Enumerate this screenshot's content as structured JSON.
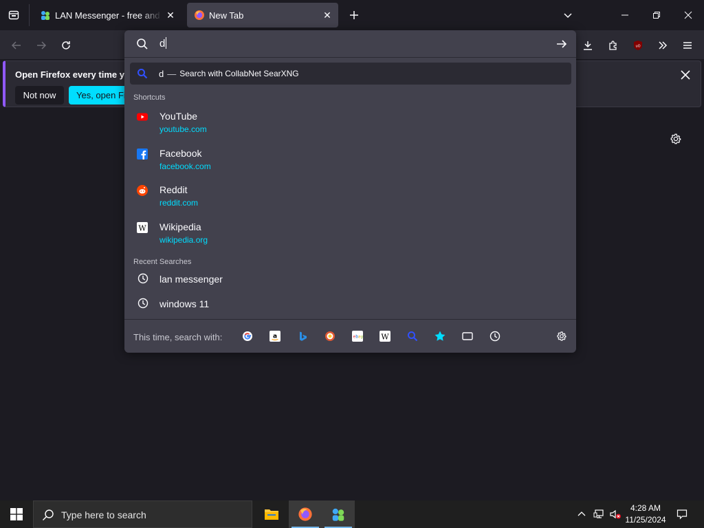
{
  "tabs": [
    {
      "title": "LAN Messenger - free and open source",
      "active": false
    },
    {
      "title": "New Tab",
      "active": true
    }
  ],
  "notification": {
    "title": "Open Firefox every time you restart your computer?",
    "not_now": "Not now",
    "yes_open": "Yes, open Firefox"
  },
  "urlbar": {
    "value": "d",
    "heuristic": {
      "query": "d",
      "separator": "—",
      "engine_text": "Search with CollabNet SearXNG"
    },
    "shortcuts_label": "Shortcuts",
    "shortcuts": [
      {
        "title": "YouTube",
        "url": "youtube.com",
        "icon": "youtube-icon"
      },
      {
        "title": "Facebook",
        "url": "facebook.com",
        "icon": "facebook-icon"
      },
      {
        "title": "Reddit",
        "url": "reddit.com",
        "icon": "reddit-icon"
      },
      {
        "title": "Wikipedia",
        "url": "wikipedia.org",
        "icon": "wikipedia-icon"
      }
    ],
    "recent_label": "Recent Searches",
    "recent": [
      "lan messenger",
      "windows 11"
    ],
    "oneoff_label": "This time, search with:",
    "oneoff_engines": [
      "google-icon",
      "amazon-icon",
      "bing-icon",
      "duckduckgo-icon",
      "ebay-icon",
      "wikipedia-icon",
      "searxng-icon",
      "bookmarks-icon",
      "tabs-icon",
      "history-icon",
      "gear-icon"
    ]
  },
  "taskbar": {
    "search_placeholder": "Type here to search",
    "time": "4:28 AM",
    "date": "11/25/2024"
  },
  "colors": {
    "accent": "#00ddff",
    "link": "#00ddff",
    "panel": "#42414d",
    "toolbar": "#2b2a33",
    "background": "#1c1b22"
  }
}
